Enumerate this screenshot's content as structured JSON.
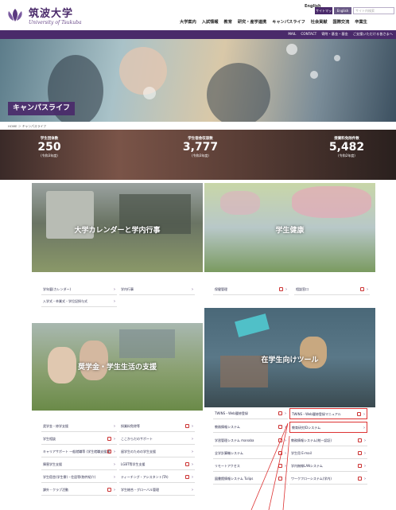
{
  "header": {
    "logo_ja": "筑波大学",
    "logo_en": "University of Tsukuba",
    "english": "English",
    "util": [
      "サイトマップ",
      "English"
    ],
    "search_placeholder": "サイト内検索",
    "global_nav": [
      "大学案内",
      "入試情報",
      "教育",
      "研究・産学連携",
      "キャンパスライフ",
      "社会貢献",
      "国際交流",
      "卒業生"
    ],
    "sub_nav": [
      "MAIL",
      "CONTACT",
      "寄附・基金・基金",
      "ご支援いただける皆さまへ"
    ]
  },
  "hero": {
    "title": "キャンパスライフ"
  },
  "breadcrumb": "HOME ＞ キャンパスライフ",
  "stats": [
    {
      "label": "学生団体数",
      "value": "250",
      "note": "(令和3年度)"
    },
    {
      "label": "学生宿舎収容数",
      "value": "3,777",
      "note": "(令和3年度)"
    },
    {
      "label": "授業料免除件数",
      "value": "5,482",
      "note": "(令和2年度)"
    }
  ],
  "panels": {
    "calendar": "大学カレンダーと学内行事",
    "health": "学生健康",
    "support": "奨学金・学生生活の支援",
    "tools": "在学生向けツール"
  },
  "calendar_links": [
    "学年暦(カレンダー)",
    "学内行事",
    "入学式・卒業式・学位記授与式"
  ],
  "health_links": [
    "保健管理",
    "相談窓口"
  ],
  "support_links": [
    [
      "奨学金・修学支援",
      "授業料免除等"
    ],
    [
      "学生相談",
      "ここからだのサポート"
    ],
    [
      "キャリアサポート 一般就職等 (学生就職支援課)",
      "留学生のための学生支援"
    ],
    [
      "障害学生支援",
      "LGBT等学生支援"
    ],
    [
      "学生宿舎(学生寮)・住居等(物件紹介)",
      "ティーチング・アシスタント(TA)"
    ],
    [
      "課外・クラブ活動",
      "学生総合・グローバル管理"
    ]
  ],
  "tool_links": [
    [
      "TWINS・Web履修登録",
      "TWINS・Web履修登録マニュアル"
    ],
    [
      "教務情報システム",
      "教育研究IDシステム"
    ],
    [
      "学習管理システム manaba",
      "教務情報システム(統一認証)"
    ],
    [
      "全学計算機システム",
      "学生用 E-mail"
    ],
    [
      "リモートアクセス",
      "学内無線LANシステム"
    ],
    [
      "図書館情報システム Tulips",
      "ワークフローシステム(学内)"
    ]
  ]
}
